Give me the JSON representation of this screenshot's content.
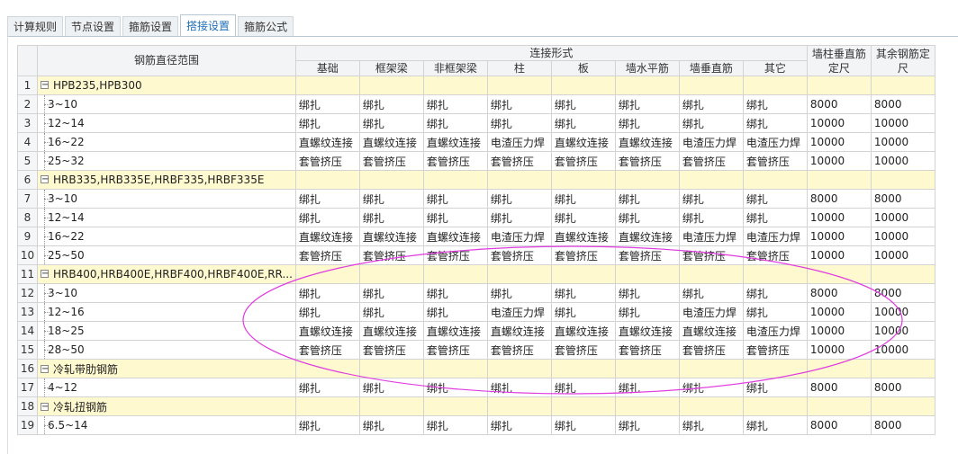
{
  "tabs": [
    {
      "label": "计算规则",
      "active": false
    },
    {
      "label": "节点设置",
      "active": false
    },
    {
      "label": "箍筋设置",
      "active": false
    },
    {
      "label": "搭接设置",
      "active": true
    },
    {
      "label": "箍筋公式",
      "active": false
    }
  ],
  "table": {
    "header": {
      "range": "钢筋直径范围",
      "connection_group": "连接形式",
      "connection_cols": [
        "基础",
        "框架梁",
        "非框架梁",
        "柱",
        "板",
        "墙水平筋",
        "墙垂直筋",
        "其它"
      ],
      "wall_col_length": "墙柱垂直筋定尺",
      "other_length": "其余钢筋定尺"
    },
    "rows": [
      {
        "n": "1",
        "type": "group",
        "name": "HPB235,HPB300"
      },
      {
        "n": "2",
        "type": "item",
        "name": "3~10",
        "cells": [
          "绑扎",
          "绑扎",
          "绑扎",
          "绑扎",
          "绑扎",
          "绑扎",
          "绑扎",
          "绑扎",
          "8000",
          "8000"
        ]
      },
      {
        "n": "3",
        "type": "item",
        "name": "12~14",
        "cells": [
          "绑扎",
          "绑扎",
          "绑扎",
          "绑扎",
          "绑扎",
          "绑扎",
          "绑扎",
          "绑扎",
          "10000",
          "10000"
        ]
      },
      {
        "n": "4",
        "type": "item",
        "name": "16~22",
        "cells": [
          "直螺纹连接",
          "直螺纹连接",
          "直螺纹连接",
          "电渣压力焊",
          "直螺纹连接",
          "直螺纹连接",
          "电渣压力焊",
          "电渣压力焊",
          "10000",
          "10000"
        ]
      },
      {
        "n": "5",
        "type": "item",
        "name": "25~32",
        "cells": [
          "套管挤压",
          "套管挤压",
          "套管挤压",
          "套管挤压",
          "套管挤压",
          "套管挤压",
          "套管挤压",
          "套管挤压",
          "10000",
          "10000"
        ]
      },
      {
        "n": "6",
        "type": "group",
        "name": "HRB335,HRB335E,HRBF335,HRBF335E"
      },
      {
        "n": "7",
        "type": "item",
        "name": "3~10",
        "cells": [
          "绑扎",
          "绑扎",
          "绑扎",
          "绑扎",
          "绑扎",
          "绑扎",
          "绑扎",
          "绑扎",
          "8000",
          "8000"
        ]
      },
      {
        "n": "8",
        "type": "item",
        "name": "12~14",
        "cells": [
          "绑扎",
          "绑扎",
          "绑扎",
          "绑扎",
          "绑扎",
          "绑扎",
          "绑扎",
          "绑扎",
          "10000",
          "10000"
        ]
      },
      {
        "n": "9",
        "type": "item",
        "name": "16~22",
        "cells": [
          "直螺纹连接",
          "直螺纹连接",
          "直螺纹连接",
          "电渣压力焊",
          "直螺纹连接",
          "直螺纹连接",
          "电渣压力焊",
          "电渣压力焊",
          "10000",
          "10000"
        ]
      },
      {
        "n": "10",
        "type": "item",
        "name": "25~50",
        "cells": [
          "套管挤压",
          "套管挤压",
          "套管挤压",
          "套管挤压",
          "套管挤压",
          "套管挤压",
          "套管挤压",
          "套管挤压",
          "10000",
          "10000"
        ]
      },
      {
        "n": "11",
        "type": "group",
        "name": "HRB400,HRB400E,HRBF400,HRBF400E,RR..."
      },
      {
        "n": "12",
        "type": "item",
        "name": "3~10",
        "cells": [
          "绑扎",
          "绑扎",
          "绑扎",
          "绑扎",
          "绑扎",
          "绑扎",
          "绑扎",
          "绑扎",
          "8000",
          "8000"
        ]
      },
      {
        "n": "13",
        "type": "item",
        "name": "12~16",
        "cells": [
          "绑扎",
          "绑扎",
          "绑扎",
          "电渣压力焊",
          "绑扎",
          "绑扎",
          "电渣压力焊",
          "绑扎",
          "10000",
          "10000"
        ]
      },
      {
        "n": "14",
        "type": "item",
        "name": "18~25",
        "cells": [
          "直螺纹连接",
          "直螺纹连接",
          "直螺纹连接",
          "直螺纹连接",
          "直螺纹连接",
          "直螺纹连接",
          "直螺纹连接",
          "电渣压力焊",
          "10000",
          "10000"
        ]
      },
      {
        "n": "15",
        "type": "item",
        "name": "28~50",
        "cells": [
          "套管挤压",
          "套管挤压",
          "套管挤压",
          "套管挤压",
          "套管挤压",
          "套管挤压",
          "套管挤压",
          "套管挤压",
          "10000",
          "10000"
        ]
      },
      {
        "n": "16",
        "type": "group",
        "name": "冷轧带肋钢筋"
      },
      {
        "n": "17",
        "type": "item",
        "name": "4~12",
        "cells": [
          "绑扎",
          "绑扎",
          "绑扎",
          "绑扎",
          "绑扎",
          "绑扎",
          "绑扎",
          "绑扎",
          "8000",
          "8000"
        ]
      },
      {
        "n": "18",
        "type": "group",
        "name": "冷轧扭钢筋"
      },
      {
        "n": "19",
        "type": "item",
        "name": "6.5~14",
        "cells": [
          "绑扎",
          "绑扎",
          "绑扎",
          "绑扎",
          "绑扎",
          "绑扎",
          "绑扎",
          "绑扎",
          "8000",
          "8000"
        ]
      }
    ]
  },
  "icons": {
    "expander": "minus-box-icon"
  },
  "expander_glyph": "−",
  "colors": {
    "group_row": "#fff9d0",
    "active_tab": "#1f6fb8",
    "annotation": "#e03be0"
  }
}
